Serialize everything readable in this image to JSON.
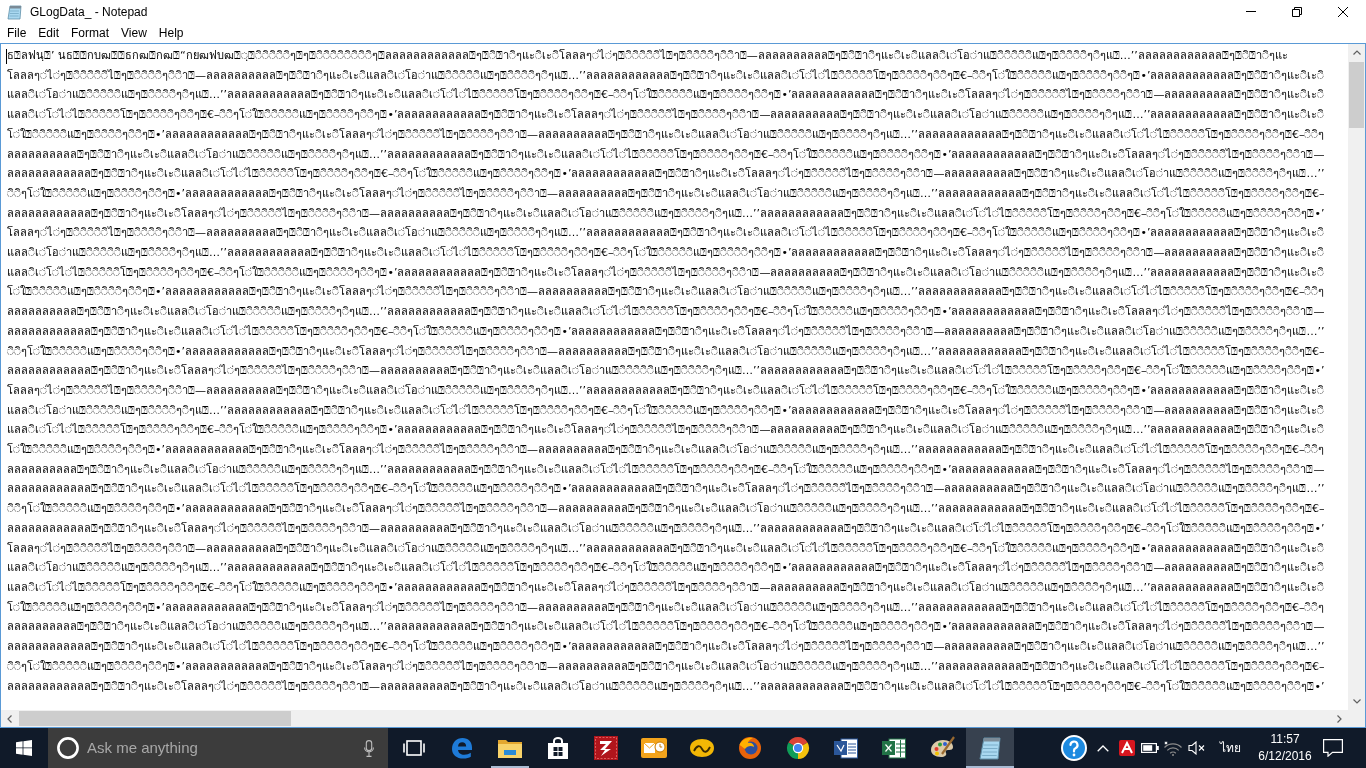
{
  "window": {
    "title": "GLogData_ - Notepad"
  },
  "menu": [
    "File",
    "Edit",
    "Format",
    "View",
    "Help"
  ],
  "editor": {
    "lines": [
      "ธ⍰ลฟนฺ⍰’ นธ⍰⍰กบฒ⍰⍰ธกฒ⍰กฒ⍰“กยฒฟบฒ⍰◌ฺ⍰◌ิ◌ิ◌ิ◌ิ◌ิๆ⍰ๆ⍰◌ิ◌ิ◌ิ◌ิ◌ิ◌ิ◌ิ◌ิๆ⍰ลลลลลลลลลลลล⍰ๆ⍰◌ิ⍰า◌ิๆแะ◌ิเะ◌ิโลลลๆ◌่ไ◌่ๆ⍰◌ิ◌ิ◌ิ◌ิ◌ิไ⍰ๆ⍰◌ิ◌ิ◌ิ◌ิๆ◌ิ◌ิา⍰—ลลลลลลลลลล⍰ๆ⍰◌ิ⍰า◌ิๆแะ◌ิเะ◌ิแลล◌ิเ◌่โอ◌่าแ⍰◌ิ◌ิ◌ิ◌ิ◌ิแ⍰ๆ⍰◌ิ◌ิ◌ิ◌ิๆ◌ิๆแ⍰…’’ลลลลลลลลลลลล⍰ๆ⍰◌ิ⍰า◌ิๆแะ",
      "โลลลๆ◌่ไ◌่ๆ⍰◌ิ◌ิ◌ิ◌ิ◌ิไ⍰ๆ⍰◌ิ◌ิ◌ิ◌ิๆ◌ิ◌ิา⍰—ลลลลลลลลลล⍰ๆ⍰◌ิ⍰า◌ิๆแะ◌ิเะ◌ิแลล◌ิเ◌่โอ◌่าแ⍰◌ิ◌ิ◌ิ◌ิ◌ิแ⍰ๆ⍰◌ิ◌ิ◌ิ◌ิๆ◌ิๆแ⍰…’’ลลลลลลลลลลลล⍰ๆ⍰◌ิ⍰า◌ิๆแะ◌ิเะ◌ิแลล◌ิเ◌่โ◌่ไ◌่ไ⍰◌ิ◌ิ◌ิ◌ิ◌ิโ⍰ๆ⍰◌ิ◌ิ◌ิ◌ิๆ◌ิ◌ิๆ⍰€–◌ิ◌ิๆโ◌่ใ⍰◌ิ◌ิ◌ิ◌ิ◌ิแ⍰ๆ⍰◌ิ◌ิ◌ิ◌ิๆ◌ิ◌ิๆ⍰•’ลลลลลลลลลลลล⍰ๆ⍰◌ิ⍰า◌ิๆแะ◌ิเะ◌ิ",
      "แลล◌ิเ◌่โอ◌่าแ⍰◌ิ◌ิ◌ิ◌ิ◌ิแ⍰ๆ⍰◌ิ◌ิ◌ิ◌ิๆ◌ิๆแ⍰…’’ลลลลลลลลลลลล⍰ๆ⍰◌ิ⍰า◌ิๆแะ◌ิเะ◌ิแลล◌ิเ◌่โ◌่ไ◌่ไ⍰◌ิ◌ิ◌ิ◌ิ◌ิโ⍰ๆ⍰◌ิ◌ิ◌ิ◌ิๆ◌ิ◌ิๆ⍰€–◌ิ◌ิๆโ◌่ใ⍰◌ิ◌ิ◌ิ◌ิ◌ิแ⍰ๆ⍰◌ิ◌ิ◌ิ◌ิๆ◌ิ◌ิๆ⍰•’ลลลลลลลลลลลล⍰ๆ⍰◌ิ⍰า◌ิๆแะ◌ิเะ◌ิโลลลๆ◌่ไ◌่ๆ⍰◌ิ◌ิ◌ิ◌ิ◌ิไ⍰ๆ⍰◌ิ◌ิ◌ิ◌ิๆ◌ิ◌ิา⍰—ลลลลลลลลลล⍰ๆ⍰◌ิ⍰า◌ิๆแะ◌ิเะ◌ิ",
      "แลล◌ิเ◌่โ◌่ไ◌่ไ⍰◌ิ◌ิ◌ิ◌ิ◌ิโ⍰ๆ⍰◌ิ◌ิ◌ิ◌ิๆ◌ิ◌ิๆ⍰€–◌ิ◌ิๆโ◌่ใ⍰◌ิ◌ิ◌ิ◌ิ◌ิแ⍰ๆ⍰◌ิ◌ิ◌ิ◌ิๆ◌ิ◌ิๆ⍰•’ลลลลลลลลลลลล⍰ๆ⍰◌ิ⍰า◌ิๆแะ◌ิเะ◌ิโลลลๆ◌่ไ◌่ๆ⍰◌ิ◌ิ◌ิ◌ิ◌ิไ⍰ๆ⍰◌ิ◌ิ◌ิ◌ิๆ◌ิ◌ิา⍰—ลลลลลลลลลล⍰ๆ⍰◌ิ⍰า◌ิๆแะ◌ิเะ◌ิแลล◌ิเ◌่โอ◌่าแ⍰◌ิ◌ิ◌ิ◌ิ◌ิแ⍰ๆ⍰◌ิ◌ิ◌ิ◌ิๆ◌ิๆแ⍰…’’ลลลลลลลลลลลล⍰ๆ⍰◌ิ⍰า◌ิๆแะ◌ิเะ◌ิ",
      "โ◌่ใ⍰◌ิ◌ิ◌ิ◌ิ◌ิแ⍰ๆ⍰◌ิ◌ิ◌ิ◌ิๆ◌ิ◌ิๆ⍰•’ลลลลลลลลลลลล⍰ๆ⍰◌ิ⍰า◌ิๆแะ◌ิเะ◌ิโลลลๆ◌่ไ◌่ๆ⍰◌ิ◌ิ◌ิ◌ิ◌ิไ⍰ๆ⍰◌ิ◌ิ◌ิ◌ิๆ◌ิ◌ิา⍰—ลลลลลลลลลล⍰ๆ⍰◌ิ⍰า◌ิๆแะ◌ิเะ◌ิแลล◌ิเ◌่โอ◌่าแ⍰◌ิ◌ิ◌ิ◌ิ◌ิแ⍰ๆ⍰◌ิ◌ิ◌ิ◌ิๆ◌ิๆแ⍰…’’ลลลลลลลลลลลล⍰ๆ⍰◌ิ⍰า◌ิๆแะ◌ิเะ◌ิแลล◌ิเ◌่โ◌่ไ◌่ไ⍰◌ิ◌ิ◌ิ◌ิ◌ิโ⍰ๆ⍰◌ิ◌ิ◌ิ◌ิๆ◌ิ◌ิๆ⍰€–◌ิ◌ิๆ",
      "ลลลลลลลลลล⍰ๆ⍰◌ิ⍰า◌ิๆแะ◌ิเะ◌ิแลล◌ิเ◌่โอ◌่าแ⍰◌ิ◌ิ◌ิ◌ิ◌ิแ⍰ๆ⍰◌ิ◌ิ◌ิ◌ิๆ◌ิๆแ⍰…’’ลลลลลลลลลลลล⍰ๆ⍰◌ิ⍰า◌ิๆแะ◌ิเะ◌ิแลล◌ิเ◌่โ◌่ไ◌่ไ⍰◌ิ◌ิ◌ิ◌ิ◌ิโ⍰ๆ⍰◌ิ◌ิ◌ิ◌ิๆ◌ิ◌ิๆ⍰€–◌ิ◌ิๆโ◌่ใ⍰◌ิ◌ิ◌ิ◌ิ◌ิแ⍰ๆ⍰◌ิ◌ิ◌ิ◌ิๆ◌ิ◌ิๆ⍰•’ลลลลลลลลลลลล⍰ๆ⍰◌ิ⍰า◌ิๆแะ◌ิเะ◌ิโลลลๆ◌่ไ◌่ๆ⍰◌ิ◌ิ◌ิ◌ิ◌ิไ⍰ๆ⍰◌ิ◌ิ◌ิ◌ิๆ◌ิ◌ิา⍰—",
      "ลลลลลลลลลลลล⍰ๆ⍰◌ิ⍰า◌ิๆแะ◌ิเะ◌ิแลล◌ิเ◌่โ◌่ไ◌่ไ⍰◌ิ◌ิ◌ิ◌ิ◌ิโ⍰ๆ⍰◌ิ◌ิ◌ิ◌ิๆ◌ิ◌ิๆ⍰€–◌ิ◌ิๆโ◌่ใ⍰◌ิ◌ิ◌ิ◌ิ◌ิแ⍰ๆ⍰◌ิ◌ิ◌ิ◌ิๆ◌ิ◌ิๆ⍰•’ลลลลลลลลลลลล⍰ๆ⍰◌ิ⍰า◌ิๆแะ◌ิเะ◌ิโลลลๆ◌่ไ◌่ๆ⍰◌ิ◌ิ◌ิ◌ิ◌ิไ⍰ๆ⍰◌ิ◌ิ◌ิ◌ิๆ◌ิ◌ิา⍰—ลลลลลลลลลล⍰ๆ⍰◌ิ⍰า◌ิๆแะ◌ิเะ◌ิแลล◌ิเ◌่โอ◌่าแ⍰◌ิ◌ิ◌ิ◌ิ◌ิแ⍰ๆ⍰◌ิ◌ิ◌ิ◌ิๆ◌ิๆแ⍰…’’",
      "◌ิ◌ิๆโ◌่ใ⍰◌ิ◌ิ◌ิ◌ิ◌ิแ⍰ๆ⍰◌ิ◌ิ◌ิ◌ิๆ◌ิ◌ิๆ⍰•’ลลลลลลลลลลลล⍰ๆ⍰◌ิ⍰า◌ิๆแะ◌ิเะ◌ิโลลลๆ◌่ไ◌่ๆ⍰◌ิ◌ิ◌ิ◌ิ◌ิไ⍰ๆ⍰◌ิ◌ิ◌ิ◌ิๆ◌ิ◌ิา⍰—ลลลลลลลลลล⍰ๆ⍰◌ิ⍰า◌ิๆแะ◌ิเะ◌ิแลล◌ิเ◌่โอ◌่าแ⍰◌ิ◌ิ◌ิ◌ิ◌ิแ⍰ๆ⍰◌ิ◌ิ◌ิ◌ิๆ◌ิๆแ⍰…’’ลลลลลลลลลลลล⍰ๆ⍰◌ิ⍰า◌ิๆแะ◌ิเะ◌ิแลล◌ิเ◌่โ◌่ไ◌่ไ⍰◌ิ◌ิ◌ิ◌ิ◌ิโ⍰ๆ⍰◌ิ◌ิ◌ิ◌ิๆ◌ิ◌ิๆ⍰€–",
      "ลลลลลลลลลลลล⍰ๆ⍰◌ิ⍰า◌ิๆแะ◌ิเะ◌ิโลลลๆ◌่ไ◌่ๆ⍰◌ิ◌ิ◌ิ◌ิ◌ิไ⍰ๆ⍰◌ิ◌ิ◌ิ◌ิๆ◌ิ◌ิา⍰—ลลลลลลลลลล⍰ๆ⍰◌ิ⍰า◌ิๆแะ◌ิเะ◌ิแลล◌ิเ◌่โอ◌่าแ⍰◌ิ◌ิ◌ิ◌ิ◌ิแ⍰ๆ⍰◌ิ◌ิ◌ิ◌ิๆ◌ิๆแ⍰…’’ลลลลลลลลลลลล⍰ๆ⍰◌ิ⍰า◌ิๆแะ◌ิเะ◌ิแลล◌ิเ◌่โ◌่ไ◌่ไ⍰◌ิ◌ิ◌ิ◌ิ◌ิโ⍰ๆ⍰◌ิ◌ิ◌ิ◌ิๆ◌ิ◌ิๆ⍰€–◌ิ◌ิๆโ◌่ใ⍰◌ิ◌ิ◌ิ◌ิ◌ิแ⍰ๆ⍰◌ิ◌ิ◌ิ◌ิๆ◌ิ◌ิๆ⍰•’",
      "โลลลๆ◌่ไ◌่ๆ⍰◌ิ◌ิ◌ิ◌ิ◌ิไ⍰ๆ⍰◌ิ◌ิ◌ิ◌ิๆ◌ิ◌ิา⍰—ลลลลลลลลลล⍰ๆ⍰◌ิ⍰า◌ิๆแะ◌ิเะ◌ิแลล◌ิเ◌่โอ◌่าแ⍰◌ิ◌ิ◌ิ◌ิ◌ิแ⍰ๆ⍰◌ิ◌ิ◌ิ◌ิๆ◌ิๆแ⍰…’’ลลลลลลลลลลลล⍰ๆ⍰◌ิ⍰า◌ิๆแะ◌ิเะ◌ิแลล◌ิเ◌่โ◌่ไ◌่ไ⍰◌ิ◌ิ◌ิ◌ิ◌ิโ⍰ๆ⍰◌ิ◌ิ◌ิ◌ิๆ◌ิ◌ิๆ⍰€–◌ิ◌ิๆโ◌่ใ⍰◌ิ◌ิ◌ิ◌ิ◌ิแ⍰ๆ⍰◌ิ◌ิ◌ิ◌ิๆ◌ิ◌ิๆ⍰•’ลลลลลลลลลลลล⍰ๆ⍰◌ิ⍰า◌ิๆแะ◌ิเะ◌ิ",
      "แลล◌ิเ◌่โอ◌่าแ⍰◌ิ◌ิ◌ิ◌ิ◌ิแ⍰ๆ⍰◌ิ◌ิ◌ิ◌ิๆ◌ิๆแ⍰…’’ลลลลลลลลลลลล⍰ๆ⍰◌ิ⍰า◌ิๆแะ◌ิเะ◌ิแลล◌ิเ◌่โ◌่ไ◌่ไ⍰◌ิ◌ิ◌ิ◌ิ◌ิโ⍰ๆ⍰◌ิ◌ิ◌ิ◌ิๆ◌ิ◌ิๆ⍰€–◌ิ◌ิๆโ◌่ใ⍰◌ิ◌ิ◌ิ◌ิ◌ิแ⍰ๆ⍰◌ิ◌ิ◌ิ◌ิๆ◌ิ◌ิๆ⍰•’ลลลลลลลลลลลล⍰ๆ⍰◌ิ⍰า◌ิๆแะ◌ิเะ◌ิโลลลๆ◌่ไ◌่ๆ⍰◌ิ◌ิ◌ิ◌ิ◌ิไ⍰ๆ⍰◌ิ◌ิ◌ิ◌ิๆ◌ิ◌ิา⍰—ลลลลลลลลลล⍰ๆ⍰◌ิ⍰า◌ิๆแะ◌ิเะ◌ิ",
      "แลล◌ิเ◌่โ◌่ไ◌่ไ⍰◌ิ◌ิ◌ิ◌ิ◌ิโ⍰ๆ⍰◌ิ◌ิ◌ิ◌ิๆ◌ิ◌ิๆ⍰€–◌ิ◌ิๆโ◌่ใ⍰◌ิ◌ิ◌ิ◌ิ◌ิแ⍰ๆ⍰◌ิ◌ิ◌ิ◌ิๆ◌ิ◌ิๆ⍰•’ลลลลลลลลลลลล⍰ๆ⍰◌ิ⍰า◌ิๆแะ◌ิเะ◌ิโลลลๆ◌่ไ◌่ๆ⍰◌ิ◌ิ◌ิ◌ิ◌ิไ⍰ๆ⍰◌ิ◌ิ◌ิ◌ิๆ◌ิ◌ิา⍰—ลลลลลลลลลล⍰ๆ⍰◌ิ⍰า◌ิๆแะ◌ิเะ◌ิแลล◌ิเ◌่โอ◌่าแ⍰◌ิ◌ิ◌ิ◌ิ◌ิแ⍰ๆ⍰◌ิ◌ิ◌ิ◌ิๆ◌ิๆแ⍰…’’ลลลลลลลลลลลล⍰ๆ⍰◌ิ⍰า◌ิๆแะ◌ิเะ◌ิ",
      "โ◌่ใ⍰◌ิ◌ิ◌ิ◌ิ◌ิแ⍰ๆ⍰◌ิ◌ิ◌ิ◌ิๆ◌ิ◌ิๆ⍰•’ลลลลลลลลลลลล⍰ๆ⍰◌ิ⍰า◌ิๆแะ◌ิเะ◌ิโลลลๆ◌่ไ◌่ๆ⍰◌ิ◌ิ◌ิ◌ิ◌ิไ⍰ๆ⍰◌ิ◌ิ◌ิ◌ิๆ◌ิ◌ิา⍰—ลลลลลลลลลล⍰ๆ⍰◌ิ⍰า◌ิๆแะ◌ิเะ◌ิแลล◌ิเ◌่โอ◌่าแ⍰◌ิ◌ิ◌ิ◌ิ◌ิแ⍰ๆ⍰◌ิ◌ิ◌ิ◌ิๆ◌ิๆแ⍰…’’ลลลลลลลลลลลล⍰ๆ⍰◌ิ⍰า◌ิๆแะ◌ิเะ◌ิแลล◌ิเ◌่โ◌่ไ◌่ไ⍰◌ิ◌ิ◌ิ◌ิ◌ิโ⍰ๆ⍰◌ิ◌ิ◌ิ◌ิๆ◌ิ◌ิๆ⍰€–◌ิ◌ิๆ",
      "ลลลลลลลลลล⍰ๆ⍰◌ิ⍰า◌ิๆแะ◌ิเะ◌ิแลล◌ิเ◌่โอ◌่าแ⍰◌ิ◌ิ◌ิ◌ิ◌ิแ⍰ๆ⍰◌ิ◌ิ◌ิ◌ิๆ◌ิๆแ⍰…’’ลลลลลลลลลลลล⍰ๆ⍰◌ิ⍰า◌ิๆแะ◌ิเะ◌ิแลล◌ิเ◌่โ◌่ไ◌่ไ⍰◌ิ◌ิ◌ิ◌ิ◌ิโ⍰ๆ⍰◌ิ◌ิ◌ิ◌ิๆ◌ิ◌ิๆ⍰€–◌ิ◌ิๆโ◌่ใ⍰◌ิ◌ิ◌ิ◌ิ◌ิแ⍰ๆ⍰◌ิ◌ิ◌ิ◌ิๆ◌ิ◌ิๆ⍰•’ลลลลลลลลลลลล⍰ๆ⍰◌ิ⍰า◌ิๆแะ◌ิเะ◌ิโลลลๆ◌่ไ◌่ๆ⍰◌ิ◌ิ◌ิ◌ิ◌ิไ⍰ๆ⍰◌ิ◌ิ◌ิ◌ิๆ◌ิ◌ิา⍰—",
      "ลลลลลลลลลลลล⍰ๆ⍰◌ิ⍰า◌ิๆแะ◌ิเะ◌ิแลล◌ิเ◌่โ◌่ไ◌่ไ⍰◌ิ◌ิ◌ิ◌ิ◌ิโ⍰ๆ⍰◌ิ◌ิ◌ิ◌ิๆ◌ิ◌ิๆ⍰€–◌ิ◌ิๆโ◌่ใ⍰◌ิ◌ิ◌ิ◌ิ◌ิแ⍰ๆ⍰◌ิ◌ิ◌ิ◌ิๆ◌ิ◌ิๆ⍰•’ลลลลลลลลลลลล⍰ๆ⍰◌ิ⍰า◌ิๆแะ◌ิเะ◌ิโลลลๆ◌่ไ◌่ๆ⍰◌ิ◌ิ◌ิ◌ิ◌ิไ⍰ๆ⍰◌ิ◌ิ◌ิ◌ิๆ◌ิ◌ิา⍰—ลลลลลลลลลล⍰ๆ⍰◌ิ⍰า◌ิๆแะ◌ิเะ◌ิแลล◌ิเ◌่โอ◌่าแ⍰◌ิ◌ิ◌ิ◌ิ◌ิแ⍰ๆ⍰◌ิ◌ิ◌ิ◌ิๆ◌ิๆแ⍰…’’",
      "◌ิ◌ิๆโ◌่ใ⍰◌ิ◌ิ◌ิ◌ิ◌ิแ⍰ๆ⍰◌ิ◌ิ◌ิ◌ิๆ◌ิ◌ิๆ⍰•’ลลลลลลลลลลลล⍰ๆ⍰◌ิ⍰า◌ิๆแะ◌ิเะ◌ิโลลลๆ◌่ไ◌่ๆ⍰◌ิ◌ิ◌ิ◌ิ◌ิไ⍰ๆ⍰◌ิ◌ิ◌ิ◌ิๆ◌ิ◌ิา⍰—ลลลลลลลลลล⍰ๆ⍰◌ิ⍰า◌ิๆแะ◌ิเะ◌ิแลล◌ิเ◌่โอ◌่าแ⍰◌ิ◌ิ◌ิ◌ิ◌ิแ⍰ๆ⍰◌ิ◌ิ◌ิ◌ิๆ◌ิๆแ⍰…’’ลลลลลลลลลลลล⍰ๆ⍰◌ิ⍰า◌ิๆแะ◌ิเะ◌ิแลล◌ิเ◌่โ◌่ไ◌่ไ⍰◌ิ◌ิ◌ิ◌ิ◌ิโ⍰ๆ⍰◌ิ◌ิ◌ิ◌ิๆ◌ิ◌ิๆ⍰€–",
      "ลลลลลลลลลลลล⍰ๆ⍰◌ิ⍰า◌ิๆแะ◌ิเะ◌ิโลลลๆ◌่ไ◌่ๆ⍰◌ิ◌ิ◌ิ◌ิ◌ิไ⍰ๆ⍰◌ิ◌ิ◌ิ◌ิๆ◌ิ◌ิา⍰—ลลลลลลลลลล⍰ๆ⍰◌ิ⍰า◌ิๆแะ◌ิเะ◌ิแลล◌ิเ◌่โอ◌่าแ⍰◌ิ◌ิ◌ิ◌ิ◌ิแ⍰ๆ⍰◌ิ◌ิ◌ิ◌ิๆ◌ิๆแ⍰…’’ลลลลลลลลลลลล⍰ๆ⍰◌ิ⍰า◌ิๆแะ◌ิเะ◌ิแลล◌ิเ◌่โ◌่ไ◌่ไ⍰◌ิ◌ิ◌ิ◌ิ◌ิโ⍰ๆ⍰◌ิ◌ิ◌ิ◌ิๆ◌ิ◌ิๆ⍰€–◌ิ◌ิๆโ◌่ใ⍰◌ิ◌ิ◌ิ◌ิ◌ิแ⍰ๆ⍰◌ิ◌ิ◌ิ◌ิๆ◌ิ◌ิๆ⍰•’",
      "โลลลๆ◌่ไ◌่ๆ⍰◌ิ◌ิ◌ิ◌ิ◌ิไ⍰ๆ⍰◌ิ◌ิ◌ิ◌ิๆ◌ิ◌ิา⍰—ลลลลลลลลลล⍰ๆ⍰◌ิ⍰า◌ิๆแะ◌ิเะ◌ิแลล◌ิเ◌่โอ◌่าแ⍰◌ิ◌ิ◌ิ◌ิ◌ิแ⍰ๆ⍰◌ิ◌ิ◌ิ◌ิๆ◌ิๆแ⍰…’’ลลลลลลลลลลลล⍰ๆ⍰◌ิ⍰า◌ิๆแะ◌ิเะ◌ิแลล◌ิเ◌่โ◌่ไ◌่ไ⍰◌ิ◌ิ◌ิ◌ิ◌ิโ⍰ๆ⍰◌ิ◌ิ◌ิ◌ิๆ◌ิ◌ิๆ⍰€–◌ิ◌ิๆโ◌่ใ⍰◌ิ◌ิ◌ิ◌ิ◌ิแ⍰ๆ⍰◌ิ◌ิ◌ิ◌ิๆ◌ิ◌ิๆ⍰•’ลลลลลลลลลลลล⍰ๆ⍰◌ิ⍰า◌ิๆแะ◌ิเะ◌ิ",
      "แลล◌ิเ◌่โอ◌่าแ⍰◌ิ◌ิ◌ิ◌ิ◌ิแ⍰ๆ⍰◌ิ◌ิ◌ิ◌ิๆ◌ิๆแ⍰…’’ลลลลลลลลลลลล⍰ๆ⍰◌ิ⍰า◌ิๆแะ◌ิเะ◌ิแลล◌ิเ◌่โ◌่ไ◌่ไ⍰◌ิ◌ิ◌ิ◌ิ◌ิโ⍰ๆ⍰◌ิ◌ิ◌ิ◌ิๆ◌ิ◌ิๆ⍰€–◌ิ◌ิๆโ◌่ใ⍰◌ิ◌ิ◌ิ◌ิ◌ิแ⍰ๆ⍰◌ิ◌ิ◌ิ◌ิๆ◌ิ◌ิๆ⍰•’ลลลลลลลลลลลล⍰ๆ⍰◌ิ⍰า◌ิๆแะ◌ิเะ◌ิโลลลๆ◌่ไ◌่ๆ⍰◌ิ◌ิ◌ิ◌ิ◌ิไ⍰ๆ⍰◌ิ◌ิ◌ิ◌ิๆ◌ิ◌ิา⍰—ลลลลลลลลลล⍰ๆ⍰◌ิ⍰า◌ิๆแะ◌ิเะ◌ิ",
      "แลล◌ิเ◌่โ◌่ไ◌่ไ⍰◌ิ◌ิ◌ิ◌ิ◌ิโ⍰ๆ⍰◌ิ◌ิ◌ิ◌ิๆ◌ิ◌ิๆ⍰€–◌ิ◌ิๆโ◌่ใ⍰◌ิ◌ิ◌ิ◌ิ◌ิแ⍰ๆ⍰◌ิ◌ิ◌ิ◌ิๆ◌ิ◌ิๆ⍰•’ลลลลลลลลลลลล⍰ๆ⍰◌ิ⍰า◌ิๆแะ◌ิเะ◌ิโลลลๆ◌่ไ◌่ๆ⍰◌ิ◌ิ◌ิ◌ิ◌ิไ⍰ๆ⍰◌ิ◌ิ◌ิ◌ิๆ◌ิ◌ิา⍰—ลลลลลลลลลล⍰ๆ⍰◌ิ⍰า◌ิๆแะ◌ิเะ◌ิแลล◌ิเ◌่โอ◌่าแ⍰◌ิ◌ิ◌ิ◌ิ◌ิแ⍰ๆ⍰◌ิ◌ิ◌ิ◌ิๆ◌ิๆแ⍰…’’ลลลลลลลลลลลล⍰ๆ⍰◌ิ⍰า◌ิๆแะ◌ิเะ◌ิ",
      "โ◌่ใ⍰◌ิ◌ิ◌ิ◌ิ◌ิแ⍰ๆ⍰◌ิ◌ิ◌ิ◌ิๆ◌ิ◌ิๆ⍰•’ลลลลลลลลลลลล⍰ๆ⍰◌ิ⍰า◌ิๆแะ◌ิเะ◌ิโลลลๆ◌่ไ◌่ๆ⍰◌ิ◌ิ◌ิ◌ิ◌ิไ⍰ๆ⍰◌ิ◌ิ◌ิ◌ิๆ◌ิ◌ิา⍰—ลลลลลลลลลล⍰ๆ⍰◌ิ⍰า◌ิๆแะ◌ิเะ◌ิแลล◌ิเ◌่โอ◌่าแ⍰◌ิ◌ิ◌ิ◌ิ◌ิแ⍰ๆ⍰◌ิ◌ิ◌ิ◌ิๆ◌ิๆแ⍰…’’ลลลลลลลลลลลล⍰ๆ⍰◌ิ⍰า◌ิๆแะ◌ิเะ◌ิแลล◌ิเ◌่โ◌่ไ◌่ไ⍰◌ิ◌ิ◌ิ◌ิ◌ิโ⍰ๆ⍰◌ิ◌ิ◌ิ◌ิๆ◌ิ◌ิๆ⍰€–◌ิ◌ิๆ",
      "ลลลลลลลลลล⍰ๆ⍰◌ิ⍰า◌ิๆแะ◌ิเะ◌ิแลล◌ิเ◌่โอ◌่าแ⍰◌ิ◌ิ◌ิ◌ิ◌ิแ⍰ๆ⍰◌ิ◌ิ◌ิ◌ิๆ◌ิๆแ⍰…’’ลลลลลลลลลลลล⍰ๆ⍰◌ิ⍰า◌ิๆแะ◌ิเะ◌ิแลล◌ิเ◌่โ◌่ไ◌่ไ⍰◌ิ◌ิ◌ิ◌ิ◌ิโ⍰ๆ⍰◌ิ◌ิ◌ิ◌ิๆ◌ิ◌ิๆ⍰€–◌ิ◌ิๆโ◌่ใ⍰◌ิ◌ิ◌ิ◌ิ◌ิแ⍰ๆ⍰◌ิ◌ิ◌ิ◌ิๆ◌ิ◌ิๆ⍰•’ลลลลลลลลลลลล⍰ๆ⍰◌ิ⍰า◌ิๆแะ◌ิเะ◌ิโลลลๆ◌่ไ◌่ๆ⍰◌ิ◌ิ◌ิ◌ิ◌ิไ⍰ๆ⍰◌ิ◌ิ◌ิ◌ิๆ◌ิ◌ิา⍰—",
      "ลลลลลลลลลลลล⍰ๆ⍰◌ิ⍰า◌ิๆแะ◌ิเะ◌ิแลล◌ิเ◌่โ◌่ไ◌่ไ⍰◌ิ◌ิ◌ิ◌ิ◌ิโ⍰ๆ⍰◌ิ◌ิ◌ิ◌ิๆ◌ิ◌ิๆ⍰€–◌ิ◌ิๆโ◌่ใ⍰◌ิ◌ิ◌ิ◌ิ◌ิแ⍰ๆ⍰◌ิ◌ิ◌ิ◌ิๆ◌ิ◌ิๆ⍰•’ลลลลลลลลลลลล⍰ๆ⍰◌ิ⍰า◌ิๆแะ◌ิเะ◌ิโลลลๆ◌่ไ◌่ๆ⍰◌ิ◌ิ◌ิ◌ิ◌ิไ⍰ๆ⍰◌ิ◌ิ◌ิ◌ิๆ◌ิ◌ิา⍰—ลลลลลลลลลล⍰ๆ⍰◌ิ⍰า◌ิๆแะ◌ิเะ◌ิแลล◌ิเ◌่โอ◌่าแ⍰◌ิ◌ิ◌ิ◌ิ◌ิแ⍰ๆ⍰◌ิ◌ิ◌ิ◌ิๆ◌ิๆแ⍰…’’",
      "◌ิ◌ิๆโ◌่ใ⍰◌ิ◌ิ◌ิ◌ิ◌ิแ⍰ๆ⍰◌ิ◌ิ◌ิ◌ิๆ◌ิ◌ิๆ⍰•’ลลลลลลลลลลลล⍰ๆ⍰◌ิ⍰า◌ิๆแะ◌ิเะ◌ิโลลลๆ◌่ไ◌่ๆ⍰◌ิ◌ิ◌ิ◌ิ◌ิไ⍰ๆ⍰◌ิ◌ิ◌ิ◌ิๆ◌ิ◌ิา⍰—ลลลลลลลลลล⍰ๆ⍰◌ิ⍰า◌ิๆแะ◌ิเะ◌ิแลล◌ิเ◌่โอ◌่าแ⍰◌ิ◌ิ◌ิ◌ิ◌ิแ⍰ๆ⍰◌ิ◌ิ◌ิ◌ิๆ◌ิๆแ⍰…’’ลลลลลลลลลลลล⍰ๆ⍰◌ิ⍰า◌ิๆแะ◌ิเะ◌ิแลล◌ิเ◌่โ◌่ไ◌่ไ⍰◌ิ◌ิ◌ิ◌ิ◌ิโ⍰ๆ⍰◌ิ◌ิ◌ิ◌ิๆ◌ิ◌ิๆ⍰€–",
      "ลลลลลลลลลลลล⍰ๆ⍰◌ิ⍰า◌ิๆแะ◌ิเะ◌ิโลลลๆ◌่ไ◌่ๆ⍰◌ิ◌ิ◌ิ◌ิ◌ิไ⍰ๆ⍰◌ิ◌ิ◌ิ◌ิๆ◌ิ◌ิา⍰—ลลลลลลลลลล⍰ๆ⍰◌ิ⍰า◌ิๆแะ◌ิเะ◌ิแลล◌ิเ◌่โอ◌่าแ⍰◌ิ◌ิ◌ิ◌ิ◌ิแ⍰ๆ⍰◌ิ◌ิ◌ิ◌ิๆ◌ิๆแ⍰…’’ลลลลลลลลลลลล⍰ๆ⍰◌ิ⍰า◌ิๆแะ◌ิเะ◌ิแลล◌ิเ◌่โ◌่ไ◌่ไ⍰◌ิ◌ิ◌ิ◌ิ◌ิโ⍰ๆ⍰◌ิ◌ิ◌ิ◌ิๆ◌ิ◌ิๆ⍰€–◌ิ◌ิๆโ◌่ใ⍰◌ิ◌ิ◌ิ◌ิ◌ิแ⍰ๆ⍰◌ิ◌ิ◌ิ◌ิๆ◌ิ◌ิๆ⍰•’",
      "โลลลๆ◌่ไ◌่ๆ⍰◌ิ◌ิ◌ิ◌ิ◌ิไ⍰ๆ⍰◌ิ◌ิ◌ิ◌ิๆ◌ิ◌ิา⍰—ลลลลลลลลลล⍰ๆ⍰◌ิ⍰า◌ิๆแะ◌ิเะ◌ิแลล◌ิเ◌่โอ◌่าแ⍰◌ิ◌ิ◌ิ◌ิ◌ิแ⍰ๆ⍰◌ิ◌ิ◌ิ◌ิๆ◌ิๆแ⍰…’’ลลลลลลลลลลลล⍰ๆ⍰◌ิ⍰า◌ิๆแะ◌ิเะ◌ิแลล◌ิเ◌่โ◌่ไ◌่ไ⍰◌ิ◌ิ◌ิ◌ิ◌ิโ⍰ๆ⍰◌ิ◌ิ◌ิ◌ิๆ◌ิ◌ิๆ⍰€–◌ิ◌ิๆโ◌่ใ⍰◌ิ◌ิ◌ิ◌ิ◌ิแ⍰ๆ⍰◌ิ◌ิ◌ิ◌ิๆ◌ิ◌ิๆ⍰•’ลลลลลลลลลลลล⍰ๆ⍰◌ิ⍰า◌ิๆแะ◌ิเะ◌ิ",
      "แลล◌ิเ◌่โอ◌่าแ⍰◌ิ◌ิ◌ิ◌ิ◌ิแ⍰ๆ⍰◌ิ◌ิ◌ิ◌ิๆ◌ิๆแ⍰…’’ลลลลลลลลลลลล⍰ๆ⍰◌ิ⍰า◌ิๆแะ◌ิเะ◌ิแลล◌ิเ◌่โ◌่ไ◌่ไ⍰◌ิ◌ิ◌ิ◌ิ◌ิโ⍰ๆ⍰◌ิ◌ิ◌ิ◌ิๆ◌ิ◌ิๆ⍰€–◌ิ◌ิๆโ◌่ใ⍰◌ิ◌ิ◌ิ◌ิ◌ิแ⍰ๆ⍰◌ิ◌ิ◌ิ◌ิๆ◌ิ◌ิๆ⍰•’ลลลลลลลลลลลล⍰ๆ⍰◌ิ⍰า◌ิๆแะ◌ิเะ◌ิโลลลๆ◌่ไ◌่ๆ⍰◌ิ◌ิ◌ิ◌ิ◌ิไ⍰ๆ⍰◌ิ◌ิ◌ิ◌ิๆ◌ิ◌ิา⍰—ลลลลลลลลลล⍰ๆ⍰◌ิ⍰า◌ิๆแะ◌ิเะ◌ิ",
      "แลล◌ิเ◌่โ◌่ไ◌่ไ⍰◌ิ◌ิ◌ิ◌ิ◌ิโ⍰ๆ⍰◌ิ◌ิ◌ิ◌ิๆ◌ิ◌ิๆ⍰€–◌ิ◌ิๆโ◌่ใ⍰◌ิ◌ิ◌ิ◌ิ◌ิแ⍰ๆ⍰◌ิ◌ิ◌ิ◌ิๆ◌ิ◌ิๆ⍰•’ลลลลลลลลลลลล⍰ๆ⍰◌ิ⍰า◌ิๆแะ◌ิเะ◌ิโลลลๆ◌่ไ◌่ๆ⍰◌ิ◌ิ◌ิ◌ิ◌ิไ⍰ๆ⍰◌ิ◌ิ◌ิ◌ิๆ◌ิ◌ิา⍰—ลลลลลลลลลล⍰ๆ⍰◌ิ⍰า◌ิๆแะ◌ิเะ◌ิแลล◌ิเ◌่โอ◌่าแ⍰◌ิ◌ิ◌ิ◌ิ◌ิแ⍰ๆ⍰◌ิ◌ิ◌ิ◌ิๆ◌ิๆแ⍰…’’ลลลลลลลลลลลล⍰ๆ⍰◌ิ⍰า◌ิๆแะ◌ิเะ◌ิ",
      "โ◌่ใ⍰◌ิ◌ิ◌ิ◌ิ◌ิแ⍰ๆ⍰◌ิ◌ิ◌ิ◌ิๆ◌ิ◌ิๆ⍰•’ลลลลลลลลลลลล⍰ๆ⍰◌ิ⍰า◌ิๆแะ◌ิเะ◌ิโลลลๆ◌่ไ◌่ๆ⍰◌ิ◌ิ◌ิ◌ิ◌ิไ⍰ๆ⍰◌ิ◌ิ◌ิ◌ิๆ◌ิ◌ิา⍰—ลลลลลลลลลล⍰ๆ⍰◌ิ⍰า◌ิๆแะ◌ิเะ◌ิแลล◌ิเ◌่โอ◌่าแ⍰◌ิ◌ิ◌ิ◌ิ◌ิแ⍰ๆ⍰◌ิ◌ิ◌ิ◌ิๆ◌ิๆแ⍰…’’ลลลลลลลลลลลล⍰ๆ⍰◌ิ⍰า◌ิๆแะ◌ิเะ◌ิแลล◌ิเ◌่โ◌่ไ◌่ไ⍰◌ิ◌ิ◌ิ◌ิ◌ิโ⍰ๆ⍰◌ิ◌ิ◌ิ◌ิๆ◌ิ◌ิๆ⍰€–◌ิ◌ิๆ",
      "ลลลลลลลลลล⍰ๆ⍰◌ิ⍰า◌ิๆแะ◌ิเะ◌ิแลล◌ิเ◌่โอ◌่าแ⍰◌ิ◌ิ◌ิ◌ิ◌ิแ⍰ๆ⍰◌ิ◌ิ◌ิ◌ิๆ◌ิๆแ⍰…’’ลลลลลลลลลลลล⍰ๆ⍰◌ิ⍰า◌ิๆแะ◌ิเะ◌ิแลล◌ิเ◌่โ◌่ไ◌่ไ⍰◌ิ◌ิ◌ิ◌ิ◌ิโ⍰ๆ⍰◌ิ◌ิ◌ิ◌ิๆ◌ิ◌ิๆ⍰€–◌ิ◌ิๆโ◌่ใ⍰◌ิ◌ิ◌ิ◌ิ◌ิแ⍰ๆ⍰◌ิ◌ิ◌ิ◌ิๆ◌ิ◌ิๆ⍰•’ลลลลลลลลลลลล⍰ๆ⍰◌ิ⍰า◌ิๆแะ◌ิเะ◌ิโลลลๆ◌่ไ◌่ๆ⍰◌ิ◌ิ◌ิ◌ิ◌ิไ⍰ๆ⍰◌ิ◌ิ◌ิ◌ิๆ◌ิ◌ิา⍰—",
      "ลลลลลลลลลลลล⍰ๆ⍰◌ิ⍰า◌ิๆแะ◌ิเะ◌ิแลล◌ิเ◌่โ◌่ไ◌่ไ⍰◌ิ◌ิ◌ิ◌ิ◌ิโ⍰ๆ⍰◌ิ◌ิ◌ิ◌ิๆ◌ิ◌ิๆ⍰€–◌ิ◌ิๆโ◌่ใ⍰◌ิ◌ิ◌ิ◌ิ◌ิแ⍰ๆ⍰◌ิ◌ิ◌ิ◌ิๆ◌ิ◌ิๆ⍰•’ลลลลลลลลลลลล⍰ๆ⍰◌ิ⍰า◌ิๆแะ◌ิเะ◌ิโลลลๆ◌่ไ◌่ๆ⍰◌ิ◌ิ◌ิ◌ิ◌ิไ⍰ๆ⍰◌ิ◌ิ◌ิ◌ิๆ◌ิ◌ิา⍰—ลลลลลลลลลล⍰ๆ⍰◌ิ⍰า◌ิๆแะ◌ิเะ◌ิแลล◌ิเ◌่โอ◌่าแ⍰◌ิ◌ิ◌ิ◌ิ◌ิแ⍰ๆ⍰◌ิ◌ิ◌ิ◌ิๆ◌ิๆแ⍰…’’",
      "◌ิ◌ิๆโ◌่ใ⍰◌ิ◌ิ◌ิ◌ิ◌ิแ⍰ๆ⍰◌ิ◌ิ◌ิ◌ิๆ◌ิ◌ิๆ⍰•’ลลลลลลลลลลลล⍰ๆ⍰◌ิ⍰า◌ิๆแะ◌ิเะ◌ิโลลลๆ◌่ไ◌่ๆ⍰◌ิ◌ิ◌ิ◌ิ◌ิไ⍰ๆ⍰◌ิ◌ิ◌ิ◌ิๆ◌ิ◌ิา⍰—ลลลลลลลลลล⍰ๆ⍰◌ิ⍰า◌ิๆแะ◌ิเะ◌ิแลล◌ิเ◌่โอ◌่าแ⍰◌ิ◌ิ◌ิ◌ิ◌ิแ⍰ๆ⍰◌ิ◌ิ◌ิ◌ิๆ◌ิๆแ⍰…’’ลลลลลลลลลลลล⍰ๆ⍰◌ิ⍰า◌ิๆแะ◌ิเะ◌ิแลล◌ิเ◌่โ◌่ไ◌่ไ⍰◌ิ◌ิ◌ิ◌ิ◌ิโ⍰ๆ⍰◌ิ◌ิ◌ิ◌ิๆ◌ิ◌ิๆ⍰€–",
      "ลลลลลลลลลลลล⍰ๆ⍰◌ิ⍰า◌ิๆแะ◌ิเะ◌ิโลลลๆ◌่ไ◌่ๆ⍰◌ิ◌ิ◌ิ◌ิ◌ิไ⍰ๆ⍰◌ิ◌ิ◌ิ◌ิๆ◌ิ◌ิา⍰—ลลลลลลลลลล⍰ๆ⍰◌ิ⍰า◌ิๆแะ◌ิเะ◌ิแลล◌ิเ◌่โอ◌่าแ⍰◌ิ◌ิ◌ิ◌ิ◌ิแ⍰ๆ⍰◌ิ◌ิ◌ิ◌ิๆ◌ิๆแ⍰…’’ลลลลลลลลลลลล⍰ๆ⍰◌ิ⍰า◌ิๆแะ◌ิเะ◌ิแลล◌ิเ◌่โ◌่ไ◌่ไ⍰◌ิ◌ิ◌ิ◌ิ◌ิโ⍰ๆ⍰◌ิ◌ิ◌ิ◌ิๆ◌ิ◌ิๆ⍰€–◌ิ◌ิๆโ◌่ใ⍰◌ิ◌ิ◌ิ◌ิ◌ิแ⍰ๆ⍰◌ิ◌ิ◌ิ◌ิๆ◌ิ◌ิๆ⍰•’"
    ]
  },
  "taskbar": {
    "search": {
      "placeholder": "Ask me anything"
    },
    "apps": [
      {
        "kind": "task-view",
        "running": false,
        "selected": false
      },
      {
        "kind": "swirl",
        "running": false,
        "selected": false
      },
      {
        "kind": "folder",
        "running": true,
        "selected": false
      },
      {
        "kind": "bag",
        "running": false,
        "selected": false
      },
      {
        "kind": "zigzag-tile",
        "running": false,
        "selected": false
      },
      {
        "kind": "envelope-clock",
        "running": false,
        "selected": false
      },
      {
        "kind": "blob",
        "running": false,
        "selected": false
      },
      {
        "kind": "globe",
        "running": false,
        "selected": false
      },
      {
        "kind": "segmented-circle",
        "running": false,
        "selected": false
      },
      {
        "kind": "document",
        "running": false,
        "selected": false
      },
      {
        "kind": "spreadsheet",
        "running": false,
        "selected": false
      },
      {
        "kind": "palette",
        "running": false,
        "selected": false
      },
      {
        "kind": "notepad",
        "running": true,
        "selected": true
      }
    ],
    "tray": {
      "language": "ไทย",
      "time": "11:57",
      "date": "6/12/2016"
    }
  }
}
